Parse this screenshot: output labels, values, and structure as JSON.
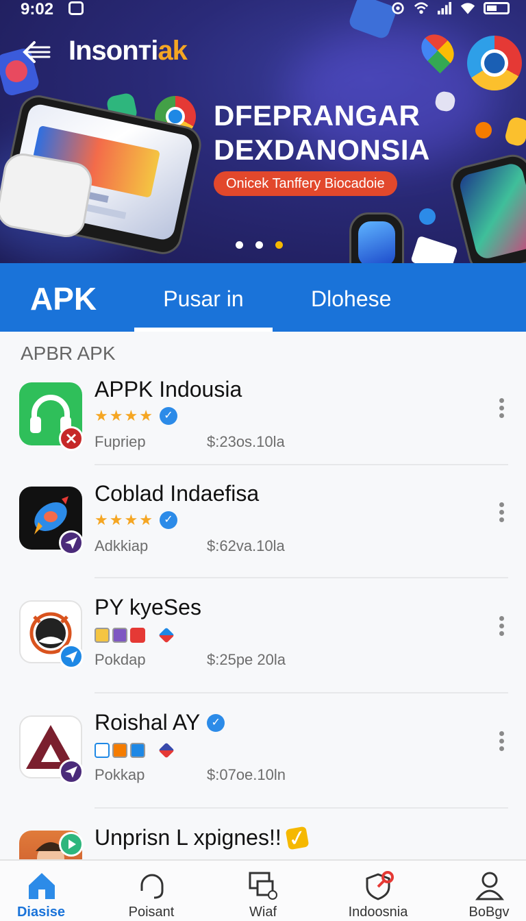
{
  "status_bar": {
    "time": "9:02"
  },
  "header": {
    "brand_main": "Insonтi",
    "brand_accent": "ak",
    "banner_line1": "DFEPRANGAR",
    "banner_line2": "DEXDANONSIA",
    "banner_pill": "Onicek Tanffery Biocadoie",
    "carousel_pages": 3,
    "carousel_active": 3
  },
  "tabs": [
    {
      "label": "APK"
    },
    {
      "label": "Pusar in"
    },
    {
      "label": "Dlohese"
    }
  ],
  "list": {
    "section_label": "APBR APK",
    "items": [
      {
        "name": "APPK Indousia",
        "publisher": "Fupriep",
        "size": "$:23os.10la",
        "rating": 4,
        "verified": true,
        "icon": "headphones-icon",
        "badge": "red-x-badge"
      },
      {
        "name": "Coblad Indaefisa",
        "publisher": "Adkkiap",
        "size": "$:62va.10la",
        "rating": 4,
        "verified": true,
        "icon": "rocket-icon",
        "badge": "purple-plane-badge"
      },
      {
        "name": "PY kyeSes",
        "publisher": "Pokdap",
        "size": "$:25pe 20la",
        "rating": 0,
        "verified": false,
        "icon": "clock-mascot-icon",
        "badge": "blue-plane-badge"
      },
      {
        "name": "Roishal AY",
        "publisher": "Pokkap",
        "size": "$:07oe.10ln",
        "rating": 0,
        "verified": true,
        "icon": "triangle-logo-icon",
        "badge": "purple-plane-badge"
      },
      {
        "name": "Unprisn L xpignes!!",
        "publisher": "",
        "size": "",
        "rating": 0,
        "verified": false,
        "icon": "person-photo-icon",
        "badge": "green-play-badge"
      }
    ]
  },
  "bottom_nav": [
    {
      "label": "Diasise",
      "icon": "home-icon",
      "active": true
    },
    {
      "label": "Poisant",
      "icon": "headset-icon",
      "active": false
    },
    {
      "label": "Wiaf",
      "icon": "devices-icon",
      "active": false
    },
    {
      "label": "Indoosnia",
      "icon": "shield-key-icon",
      "active": false
    },
    {
      "label": "BoBgv",
      "icon": "user-icon",
      "active": false
    }
  ],
  "colors": {
    "accent": "#1a73d9",
    "brand_accent": "#f5a623",
    "pill": "#e2482c",
    "star": "#f5a623",
    "verified": "#2c8be8"
  }
}
